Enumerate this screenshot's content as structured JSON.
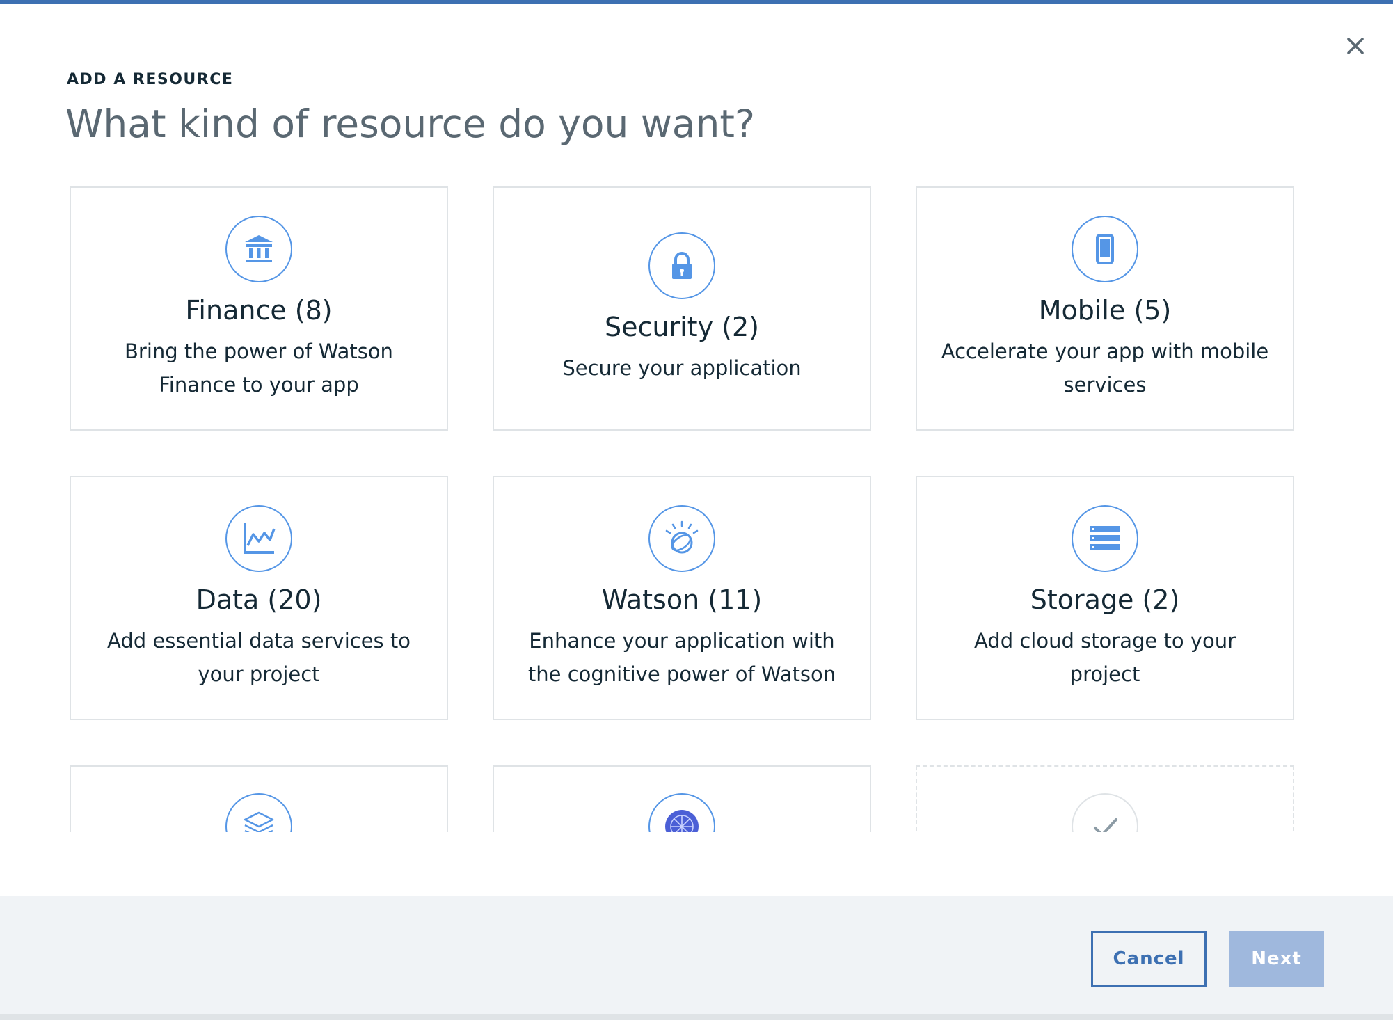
{
  "dialog": {
    "label": "ADD A RESOURCE",
    "heading": "What kind of resource do you want?",
    "close_icon": "close-icon"
  },
  "tiles": [
    {
      "title": "Finance (8)",
      "description": "Bring the power of Watson Finance to your app",
      "icon": "bank-icon"
    },
    {
      "title": "Security (2)",
      "description": "Secure your application",
      "icon": "lock-icon"
    },
    {
      "title": "Mobile (5)",
      "description": "Accelerate your app with mobile services",
      "icon": "mobile-phone-icon"
    },
    {
      "title": "Data (20)",
      "description": "Add essential data services to your project",
      "icon": "line-chart-icon"
    },
    {
      "title": "Watson (11)",
      "description": "Enhance your application with the cognitive power of Watson",
      "icon": "watson-icon"
    },
    {
      "title": "Storage (2)",
      "description": "Add cloud storage to your project",
      "icon": "storage-icon"
    }
  ],
  "partial_tiles": [
    {
      "icon": "layers-icon"
    },
    {
      "icon": "network-sphere-icon"
    },
    {
      "icon": "checkmark-icon"
    }
  ],
  "footer": {
    "cancel_label": "Cancel",
    "next_label": "Next"
  },
  "colors": {
    "accent": "#3d70b2",
    "icon_blue": "#5596e6",
    "next_disabled": "#9fb8dd",
    "footer_bg": "#f0f3f6",
    "text_dark": "#152935",
    "text_grey": "#5a6872"
  }
}
